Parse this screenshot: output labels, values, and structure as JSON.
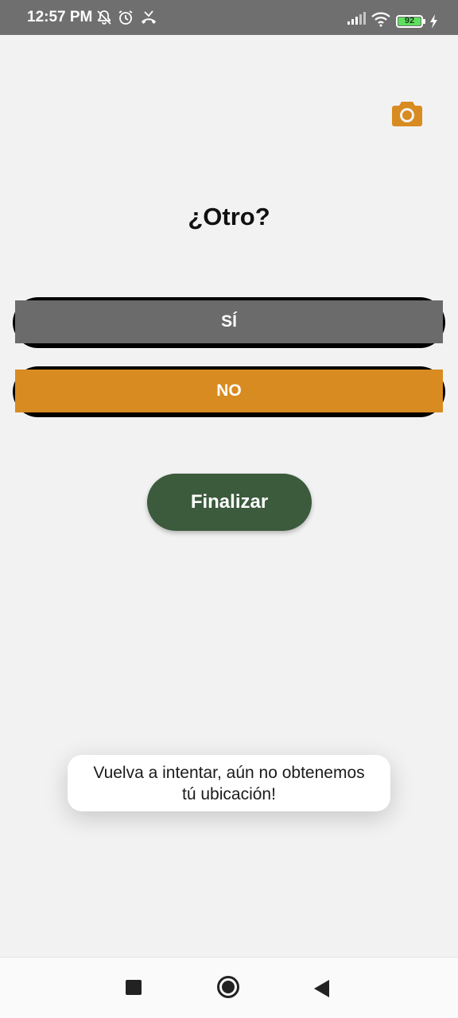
{
  "status_bar": {
    "time": "12:57 PM",
    "icons": [
      "notifications-off-icon",
      "alarm-icon",
      "missed-call-icon",
      "signal-icon",
      "wifi-icon",
      "battery-icon",
      "charging-icon"
    ],
    "battery_level": "92"
  },
  "header": {
    "camera_icon": "camera-icon",
    "accent_color": "#d88b20"
  },
  "question": {
    "title": "¿Otro?"
  },
  "options": {
    "yes_label": "SÍ",
    "no_label": "NO"
  },
  "actions": {
    "finish_label": "Finalizar"
  },
  "toast": {
    "line1": "Vuelva a intentar, aún no obtenemos",
    "line2": "tú ubicación!"
  },
  "nav_bar": {
    "icons": [
      "recents-icon",
      "home-icon",
      "back-icon"
    ]
  },
  "colors": {
    "yes_button": "#6b6b6b",
    "no_button": "#d88b20",
    "finish_button": "#3c5a3c"
  }
}
